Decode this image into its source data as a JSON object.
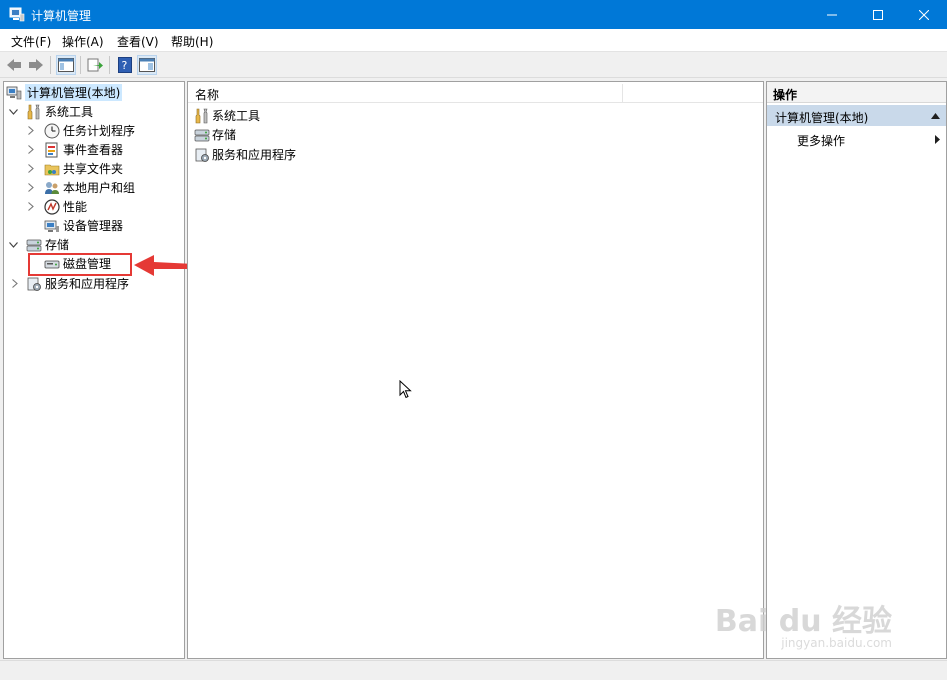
{
  "window": {
    "title": "计算机管理"
  },
  "menu": [
    "文件(F)",
    "操作(A)",
    "查看(V)",
    "帮助(H)"
  ],
  "tree": {
    "root": "计算机管理(本地)",
    "system_tools": "系统工具",
    "task_scheduler": "任务计划程序",
    "event_viewer": "事件查看器",
    "shared_folders": "共享文件夹",
    "local_users": "本地用户和组",
    "performance": "性能",
    "device_manager": "设备管理器",
    "storage": "存储",
    "disk_management": "磁盘管理",
    "services_apps": "服务和应用程序"
  },
  "middle": {
    "column_name": "名称",
    "items": [
      "系统工具",
      "存储",
      "服务和应用程序"
    ]
  },
  "actions": {
    "header": "操作",
    "section": "计算机管理(本地)",
    "more": "更多操作"
  },
  "watermark": {
    "brand": "Bai du 经验",
    "url": "jingyan.baidu.com"
  },
  "colors": {
    "titlebar": "#0078d7",
    "selection": "#cce8ff",
    "annotation": "#e53935"
  }
}
